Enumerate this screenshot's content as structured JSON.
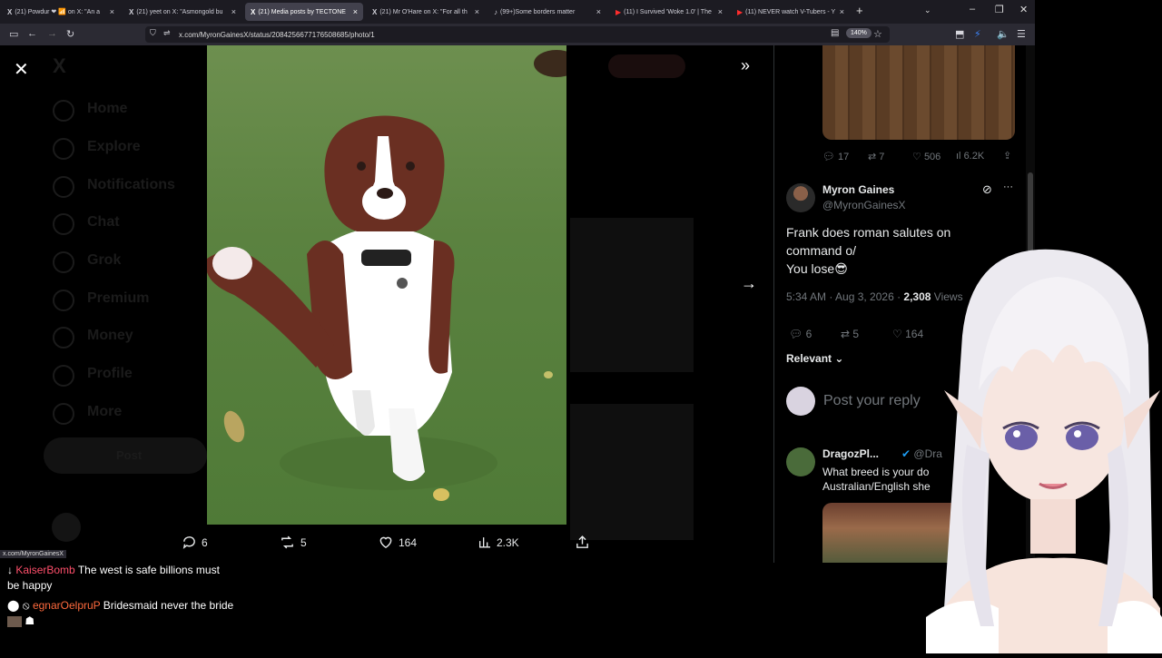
{
  "browser": {
    "tabs": [
      {
        "title": "(21) Powdur ❤ 📶 on X: \"An a",
        "active": false
      },
      {
        "title": "(21) yeet on X: \"Asmongold bu",
        "active": false
      },
      {
        "title": "(21) Media posts by TECTONE",
        "active": true
      },
      {
        "title": "(21) Mr O'Hare on X: \"For all th",
        "active": false
      },
      {
        "title": "(99+)Some borders matter",
        "active": false
      },
      {
        "title": "(11) I Survived 'Woke 1.0' | The",
        "active": false
      },
      {
        "title": "(11) NEVER watch V-Tubers - Y",
        "active": false
      }
    ],
    "url": "x.com/MyronGainesX/status/2084256677176508685/photo/1",
    "zoom": "140%",
    "status_url": "x.com/MyronGainesX"
  },
  "x_nav": [
    "Home",
    "Explore",
    "Notifications",
    "Chat",
    "Grok",
    "Premium",
    "Money",
    "Profile",
    "More"
  ],
  "x_nav_post": "Post",
  "media_actions": {
    "replies": "6",
    "reposts": "5",
    "likes": "164",
    "views": "2.3K"
  },
  "prev_tweet_stats": {
    "replies": "17",
    "reposts": "7",
    "likes": "506",
    "views": "6.2K"
  },
  "tweet": {
    "name": "Myron Gaines",
    "handle": "@MyronGainesX",
    "text_line1": "Frank does roman salutes on",
    "text_line2": "command o/",
    "text_line3": "You lose😎",
    "time": "5:34 AM · Aug 3, 2026 · ",
    "views_count": "2,308",
    "views_label": " Views",
    "replies": "6",
    "reposts": "5",
    "likes": "164"
  },
  "sort_label": "Relevant",
  "reply_placeholder": "Post your reply",
  "reply": {
    "name": "DragozPl...",
    "handle": "@Dra",
    "text_line1": "What breed is your do",
    "text_line2": "Australian/English she"
  },
  "chat": [
    {
      "user": "KaiserBomb",
      "message": "The west is safe billions must be happy"
    },
    {
      "user": "egnarOelpruP",
      "message": "Bridesmaid never the bride"
    }
  ]
}
